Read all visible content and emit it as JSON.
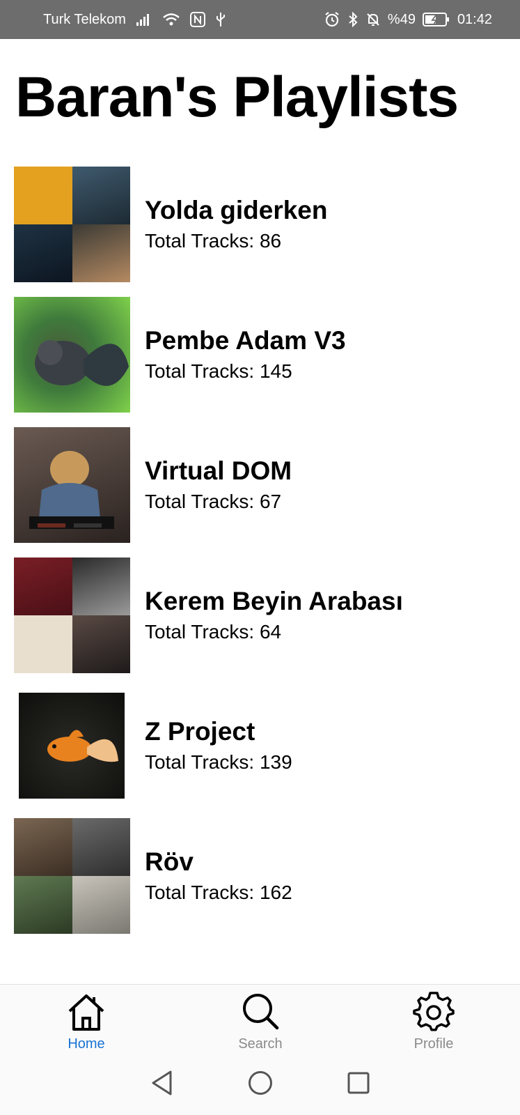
{
  "status_bar": {
    "carrier": "Turk Telekom",
    "battery": "%49",
    "time": "01:42"
  },
  "page": {
    "title": "Baran's Playlists"
  },
  "playlists": [
    {
      "name": "Yolda giderken",
      "tracks": "Total Tracks: 86"
    },
    {
      "name": "Pembe Adam V3",
      "tracks": "Total Tracks: 145"
    },
    {
      "name": "Virtual DOM",
      "tracks": "Total Tracks: 67"
    },
    {
      "name": "Kerem Beyin Arabası",
      "tracks": "Total Tracks: 64"
    },
    {
      "name": "Z Project",
      "tracks": "Total Tracks: 139"
    },
    {
      "name": "Röv",
      "tracks": "Total Tracks: 162"
    }
  ],
  "bottom_nav": {
    "home": "Home",
    "search": "Search",
    "profile": "Profile",
    "active": "home"
  },
  "colors": {
    "accent": "#1a73d4",
    "status_bar_bg": "#6d6d6d",
    "inactive_label": "#8a8a8a"
  },
  "icons": {
    "signal": "signal-icon",
    "wifi": "wifi-icon",
    "nfc": "nfc-icon",
    "usb": "usb-icon",
    "alarm": "alarm-icon",
    "bluetooth": "bluetooth-icon",
    "mute": "bell-off-icon",
    "battery": "battery-charging-icon",
    "home": "home-icon",
    "search": "search-icon",
    "profile": "gear-icon",
    "back": "back-triangle-icon",
    "sys_home": "home-circle-icon",
    "recents": "recents-square-icon"
  }
}
